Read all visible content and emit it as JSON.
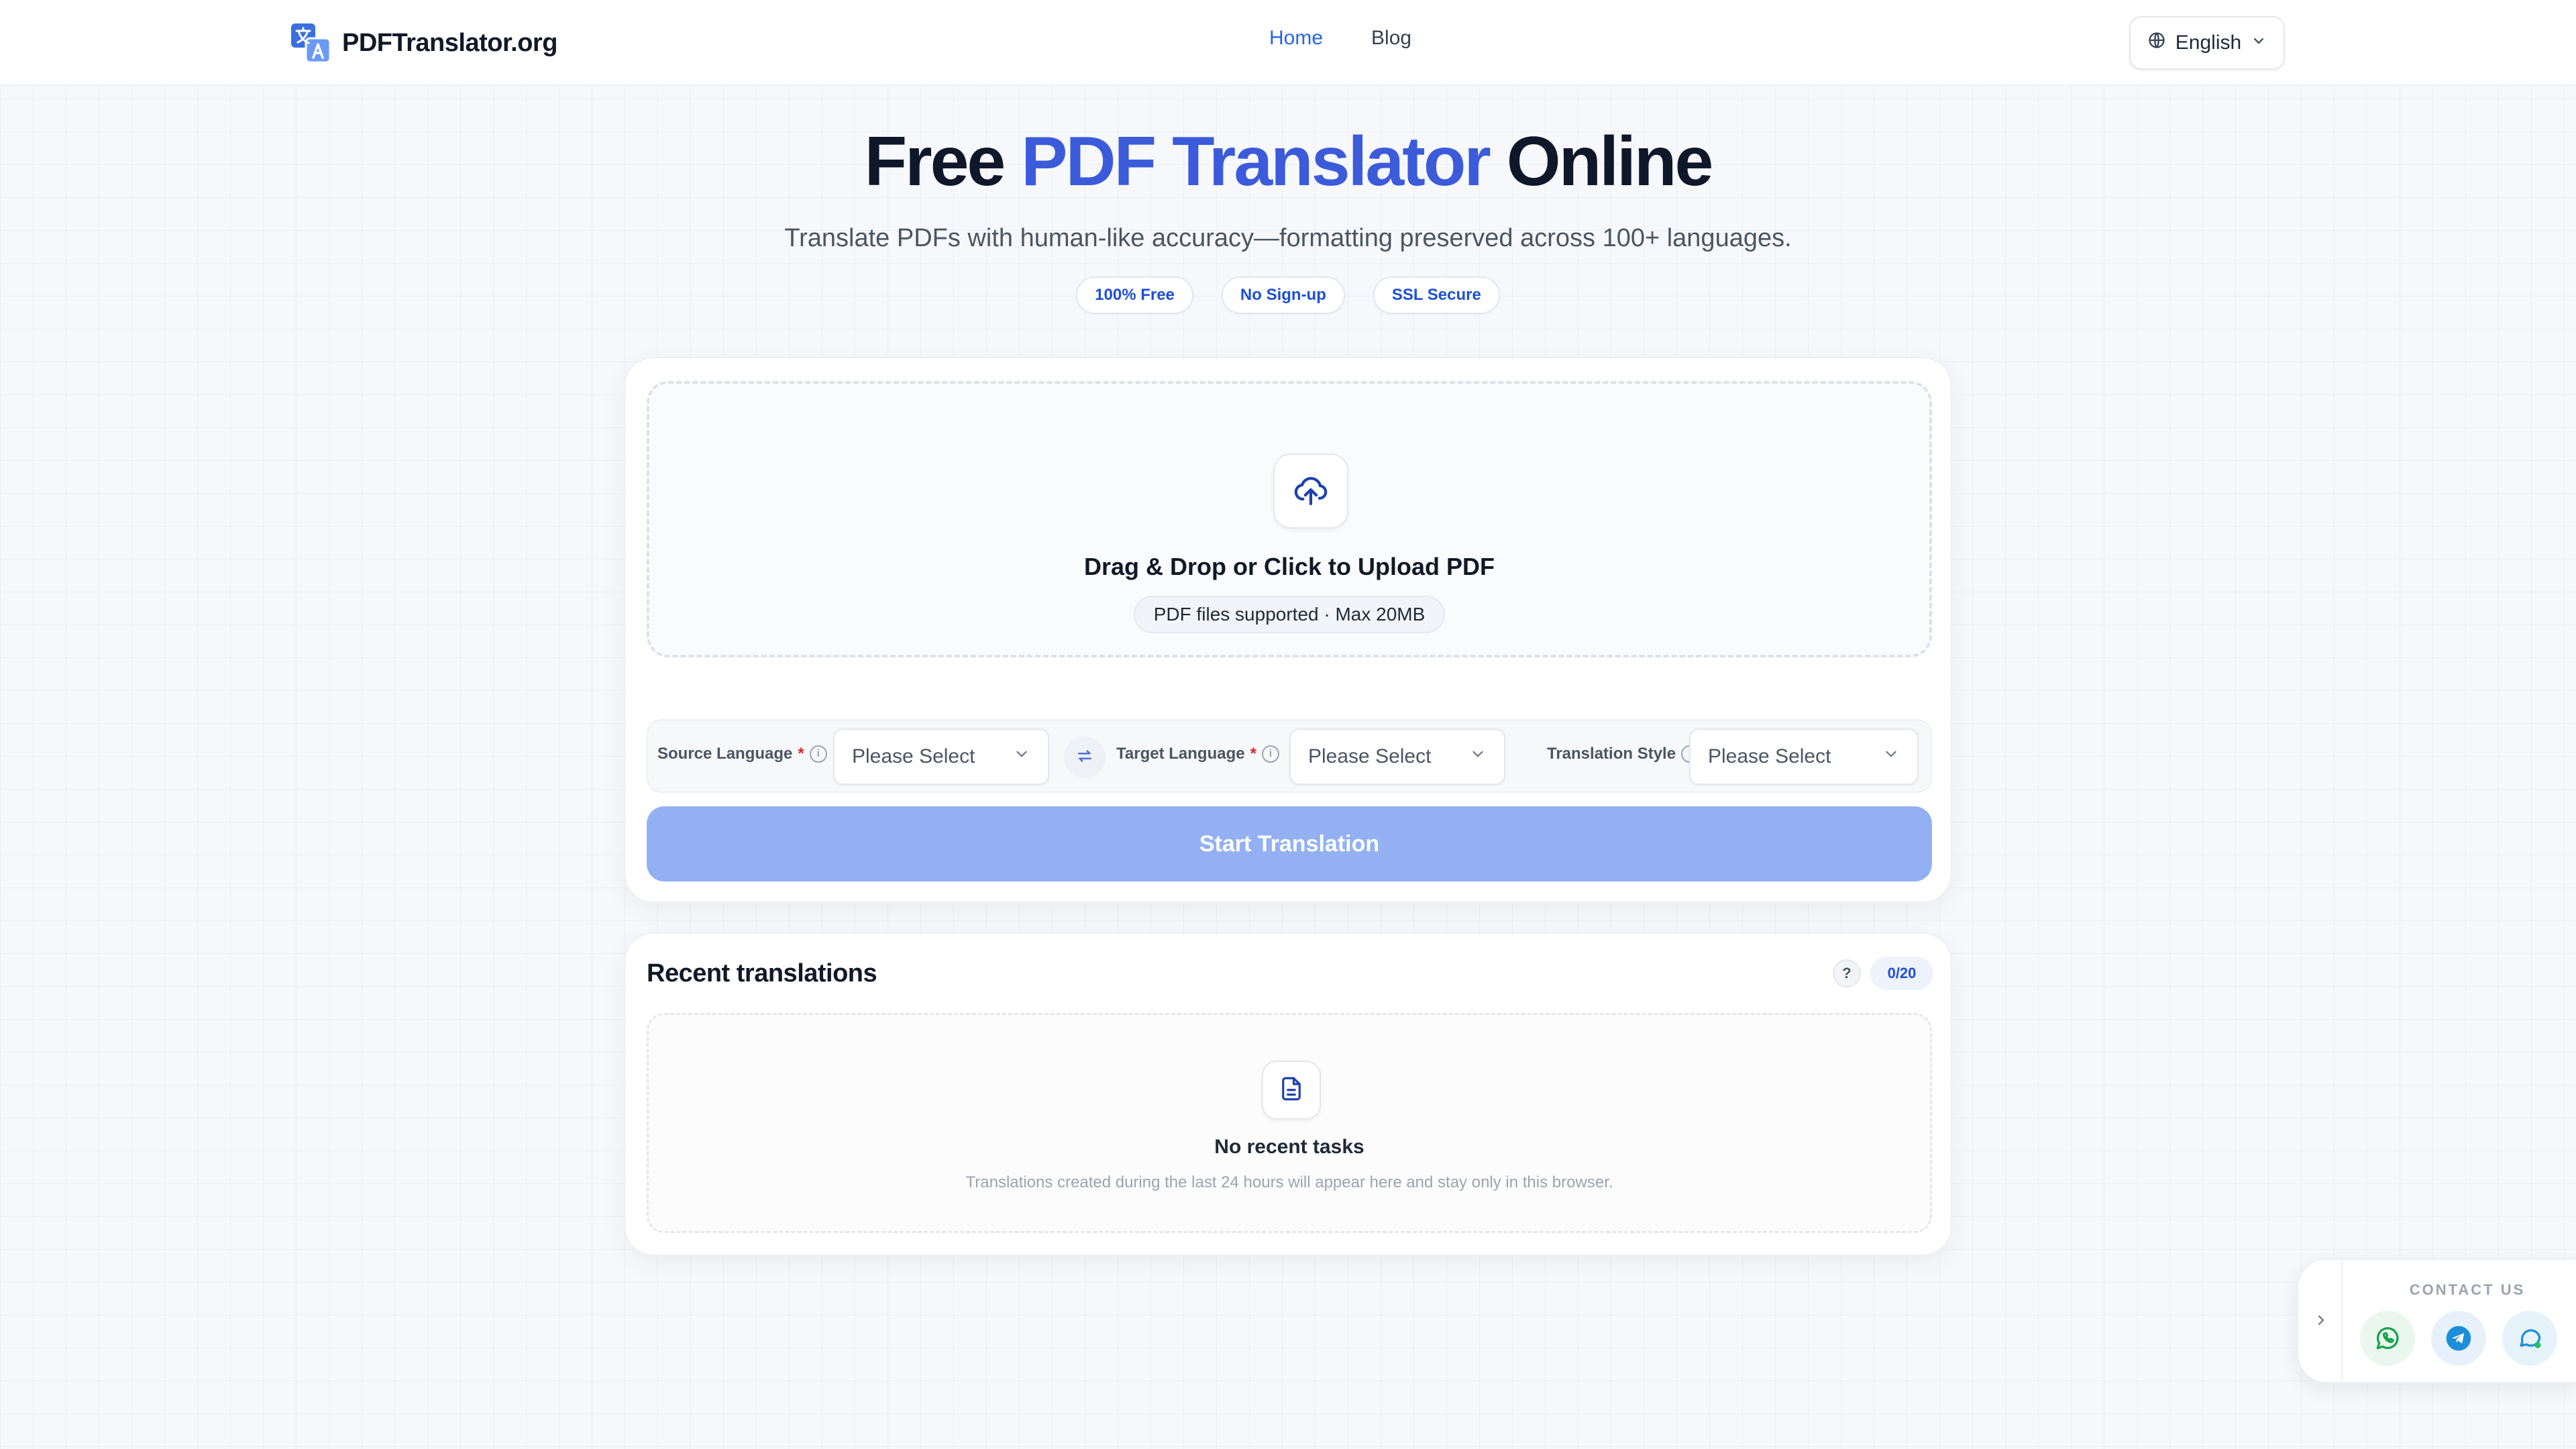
{
  "header": {
    "brand": "PDFTranslator.org",
    "nav": [
      {
        "label": "Home",
        "active": true
      },
      {
        "label": "Blog",
        "active": false
      }
    ],
    "language": "English"
  },
  "hero": {
    "title_start": "Free ",
    "title_accent": "PDF Translator",
    "title_end": " Online",
    "subtitle": "Translate PDFs with human-like accuracy—formatting preserved across 100+ languages.",
    "badges": [
      "100% Free",
      "No Sign-up",
      "SSL Secure"
    ]
  },
  "upload": {
    "title": "Drag & Drop or Click to Upload PDF",
    "hint": "PDF files supported · Max 20MB"
  },
  "options": {
    "source_label": "Source Language",
    "source_value": "Please Select",
    "target_label": "Target Language",
    "target_value": "Please Select",
    "style_label": "Translation Style",
    "style_value": "Please Select",
    "required_mark": "*"
  },
  "start_button": "Start Translation",
  "recent": {
    "title": "Recent translations",
    "help": "?",
    "count": "0/20",
    "empty_title": "No recent tasks",
    "empty_desc": "Translations created during the last 24 hours will appear here and stay only in this browser."
  },
  "contact": {
    "label": "CONTACT US",
    "icons": [
      "whatsapp-icon",
      "telegram-icon",
      "chat-icon"
    ]
  },
  "colors": {
    "accent": "#3b5bdb",
    "link": "#2563eb",
    "button_disabled": "#93b1f2",
    "required": "#dc2626"
  }
}
